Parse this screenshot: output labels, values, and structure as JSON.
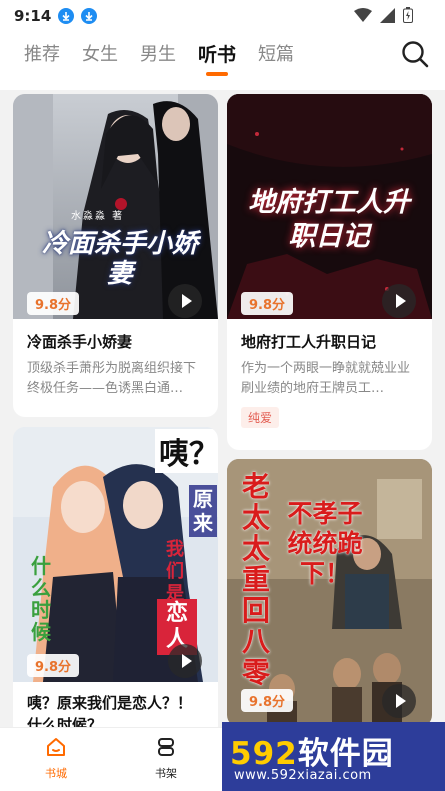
{
  "status": {
    "time": "9:14"
  },
  "tabs": [
    {
      "label": "推荐"
    },
    {
      "label": "女生"
    },
    {
      "label": "男生"
    },
    {
      "label": "听书"
    },
    {
      "label": "短篇"
    }
  ],
  "active_tab": "听书",
  "books": [
    {
      "rating": "9.8分",
      "title": "冷面杀手小娇妻",
      "desc": "顶级杀手萧彤为脱离组织接下终极任务——色诱黑白通…",
      "cover_text": "冷面杀手小娇妻",
      "cover_author": "水淼淼 著"
    },
    {
      "rating": "9.8分",
      "title": "地府打工人升职日记",
      "desc": "作为一个两眼一睁就就兢业业刷业绩的地府王牌员工…",
      "tag": "纯爱",
      "cover_text": "地府打工人升职日记"
    },
    {
      "rating": "9.8分",
      "title": "咦？原来我们是恋人？！什么时候？",
      "cover_text_a": "咦？",
      "cover_text_b": "原来",
      "cover_text_c": "我们是",
      "cover_text_d": "恋人",
      "cover_text_e": "什么时候"
    },
    {
      "rating": "9.8分",
      "cover_text_a": "老太太重回八零",
      "cover_text_b": "不孝子统统跪下！"
    }
  ],
  "nav": [
    {
      "label": "书城"
    },
    {
      "label": "书架"
    }
  ],
  "watermark": {
    "big_a": "592",
    "big_b": "软件园",
    "small": "www.592xiazai.com"
  },
  "colors": {
    "accent": "#ff6a00",
    "rating": "#e8732d",
    "tag_bg": "#fdeeea",
    "tag_text": "#e35d52",
    "nav_active": "#ff6a00"
  }
}
